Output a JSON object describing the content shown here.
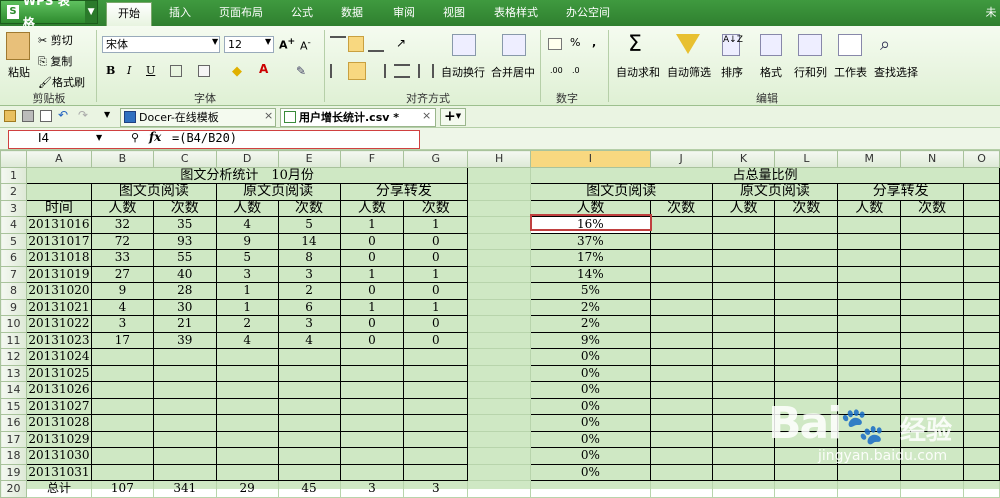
{
  "app": {
    "name": "WPS 表格",
    "user": "未"
  },
  "menu": [
    "开始",
    "插入",
    "页面布局",
    "公式",
    "数据",
    "审阅",
    "视图",
    "表格样式",
    "办公空间"
  ],
  "ribbon": {
    "clipboard": {
      "paste": "粘贴",
      "cut": "剪切",
      "copy": "复制",
      "format_painter": "格式刷",
      "label": "剪贴板"
    },
    "font": {
      "name": "宋体",
      "size": "12",
      "label": "字体",
      "bold": "B",
      "italic": "I",
      "underline": "U"
    },
    "align": {
      "wrap": "自动换行",
      "merge": "合并居中",
      "label": "对齐方式"
    },
    "number": {
      "label": "数字"
    },
    "edit": {
      "autosum": "自动求和",
      "autofilter": "自动筛选",
      "sort": "排序",
      "format": "格式",
      "rowcol": "行和列",
      "worksheet": "工作表",
      "find": "查找选择",
      "label": "编辑"
    }
  },
  "doc_tabs": [
    {
      "label": "Docer-在线模板",
      "close": "×"
    },
    {
      "label": "用户增长统计.csv *",
      "close": "×"
    }
  ],
  "formula_bar": {
    "cell": "I4",
    "formula": "=(B4/B20)",
    "fx": "fx"
  },
  "columns": [
    "A",
    "B",
    "C",
    "D",
    "E",
    "F",
    "G",
    "H",
    "I",
    "J",
    "K",
    "L",
    "M",
    "N",
    "O"
  ],
  "rows": [
    "1",
    "2",
    "3",
    "4",
    "5",
    "6",
    "7",
    "8",
    "9",
    "10",
    "11",
    "12",
    "13",
    "14",
    "15",
    "16",
    "17",
    "18",
    "19",
    "20"
  ],
  "left_table": {
    "title": "图文分析统计　10月份",
    "groups": [
      "图文页阅读",
      "原文页阅读",
      "分享转发"
    ],
    "time_label": "时间",
    "sub_headers": [
      "人数",
      "次数",
      "人数",
      "次数",
      "人数",
      "次数"
    ],
    "data": [
      [
        "20131016",
        "32",
        "35",
        "4",
        "5",
        "1",
        "1"
      ],
      [
        "20131017",
        "72",
        "93",
        "9",
        "14",
        "0",
        "0"
      ],
      [
        "20131018",
        "33",
        "55",
        "5",
        "8",
        "0",
        "0"
      ],
      [
        "20131019",
        "27",
        "40",
        "3",
        "3",
        "1",
        "1"
      ],
      [
        "20131020",
        "9",
        "28",
        "1",
        "2",
        "0",
        "0"
      ],
      [
        "20131021",
        "4",
        "30",
        "1",
        "6",
        "1",
        "1"
      ],
      [
        "20131022",
        "3",
        "21",
        "2",
        "3",
        "0",
        "0"
      ],
      [
        "20131023",
        "17",
        "39",
        "4",
        "4",
        "0",
        "0"
      ],
      [
        "20131024",
        "",
        "",
        "",
        "",
        "",
        ""
      ],
      [
        "20131025",
        "",
        "",
        "",
        "",
        "",
        ""
      ],
      [
        "20131026",
        "",
        "",
        "",
        "",
        "",
        ""
      ],
      [
        "20131027",
        "",
        "",
        "",
        "",
        "",
        ""
      ],
      [
        "20131028",
        "",
        "",
        "",
        "",
        "",
        ""
      ],
      [
        "20131029",
        "",
        "",
        "",
        "",
        "",
        ""
      ],
      [
        "20131030",
        "",
        "",
        "",
        "",
        "",
        ""
      ],
      [
        "20131031",
        "",
        "",
        "",
        "",
        "",
        ""
      ]
    ],
    "total": [
      "总计",
      "107",
      "341",
      "29",
      "45",
      "3",
      "3"
    ]
  },
  "right_table": {
    "title": "占总量比例",
    "groups": [
      "图文页阅读",
      "原文页阅读",
      "分享转发"
    ],
    "sub_headers": [
      "人数",
      "次数",
      "人数",
      "次数",
      "人数",
      "次数"
    ],
    "percents": [
      "16%",
      "37%",
      "17%",
      "14%",
      "5%",
      "2%",
      "2%",
      "9%",
      "0%",
      "0%",
      "0%",
      "0%",
      "0%",
      "0%",
      "0%",
      "0%"
    ]
  },
  "watermark": {
    "brand": "Bai",
    "brand2": "经验",
    "url": "jingyan.baidu.com"
  }
}
